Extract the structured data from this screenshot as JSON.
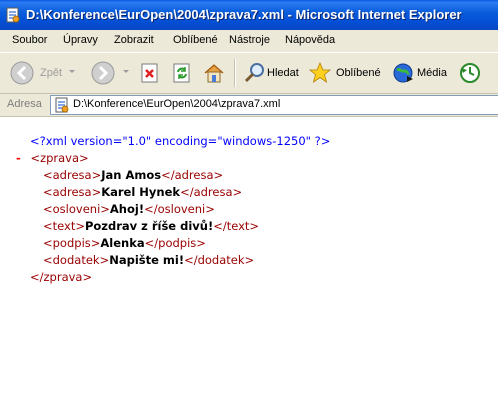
{
  "window": {
    "title": "D:\\Konference\\EurOpen\\2004\\zprava7.xml - Microsoft Internet Explorer"
  },
  "menu": {
    "items": [
      "Soubor",
      "Úpravy",
      "Zobrazit",
      "Oblíbené",
      "Nástroje",
      "Nápověda"
    ]
  },
  "toolbar": {
    "back_label": "Zpět",
    "search_label": "Hledat",
    "favorites_label": "Oblíbené",
    "media_label": "Média"
  },
  "address": {
    "label": "Adresa",
    "value": "D:\\Konference\\EurOpen\\2004\\zprava7.xml"
  },
  "xml": {
    "declaration": "<?xml version=\"1.0\" encoding=\"windows-1250\" ?>",
    "collapse_marker": "-",
    "root_open": "<zprava>",
    "root_close": "</zprava>",
    "elements": [
      {
        "open": "<adresa>",
        "text": "Jan Amos",
        "close": "</adresa>"
      },
      {
        "open": "<adresa>",
        "text": "Karel Hynek",
        "close": "</adresa>"
      },
      {
        "open": "<osloveni>",
        "text": "Ahoj!",
        "close": "</osloveni>"
      },
      {
        "open": "<text>",
        "text": "Pozdrav z říše divů!",
        "close": "</text>"
      },
      {
        "open": "<podpis>",
        "text": "Alenka",
        "close": "</podpis>"
      },
      {
        "open": "<dodatek>",
        "text": "Napište mi!",
        "close": "</dodatek>"
      }
    ]
  }
}
